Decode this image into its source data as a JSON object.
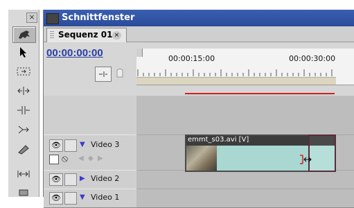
{
  "tools": {
    "close_label": "×",
    "items": [
      {
        "name": "logo-horse-icon"
      },
      {
        "name": "selection-arrow-icon"
      },
      {
        "name": "track-select-icon"
      },
      {
        "name": "ripple-edit-icon"
      },
      {
        "name": "rolling-edit-icon"
      },
      {
        "name": "rate-stretch-icon"
      },
      {
        "name": "razor-icon"
      },
      {
        "name": "slip-icon"
      },
      {
        "name": "slide-icon"
      }
    ]
  },
  "window": {
    "title": "Schnittfenster",
    "tab_label": "Sequenz 01",
    "tab_close": "×"
  },
  "timeline": {
    "current_timecode": "00:00:00:00",
    "ruler_labels": [
      "00:00:15:00",
      "00:00:30:00"
    ]
  },
  "tracks": [
    {
      "name": "Video 3",
      "expanded": true
    },
    {
      "name": "Video 2",
      "expanded": false
    },
    {
      "name": "Video 1",
      "expanded": true
    }
  ],
  "clip": {
    "label": "emmt_s03.avi [V]"
  },
  "colors": {
    "title_bar": "#2a4c9a",
    "timecode": "#2a3ea6",
    "clip_fill": "#a9d7d2",
    "render_line": "#d02020"
  }
}
